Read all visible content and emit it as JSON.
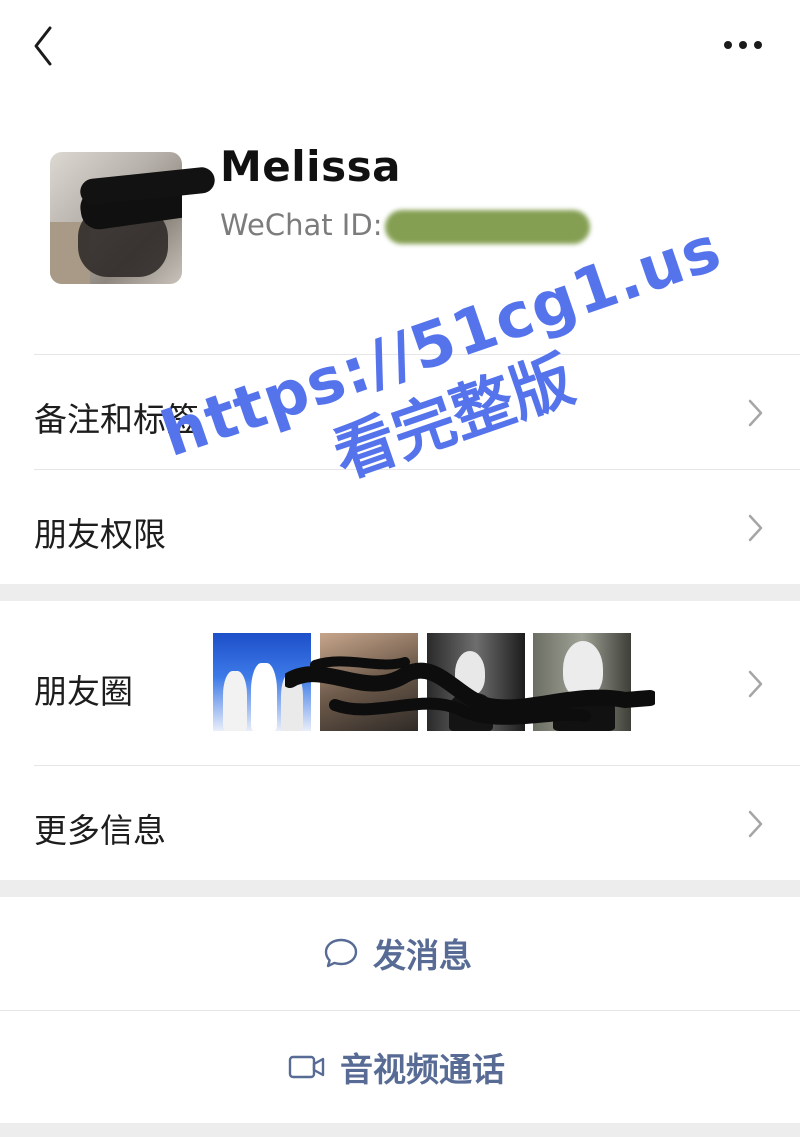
{
  "topbar": {
    "back_icon": "chevron-left-icon",
    "more_icon": "more-dots-icon"
  },
  "profile": {
    "name": "Melissa",
    "wechat_id_label": "WeChat ID:"
  },
  "rows": {
    "remark_tags": "备注和标签",
    "friend_permissions": "朋友权限",
    "moments": "朋友圈",
    "more_info": "更多信息"
  },
  "actions": {
    "send_message": "发消息",
    "video_call": "音视频通话"
  },
  "watermark": {
    "line1": "https://51cg1.us",
    "line2": "看完整版"
  },
  "colors": {
    "link_blue": "#576b95",
    "watermark_blue": "#5574ec",
    "separator_gray": "#ededed"
  }
}
